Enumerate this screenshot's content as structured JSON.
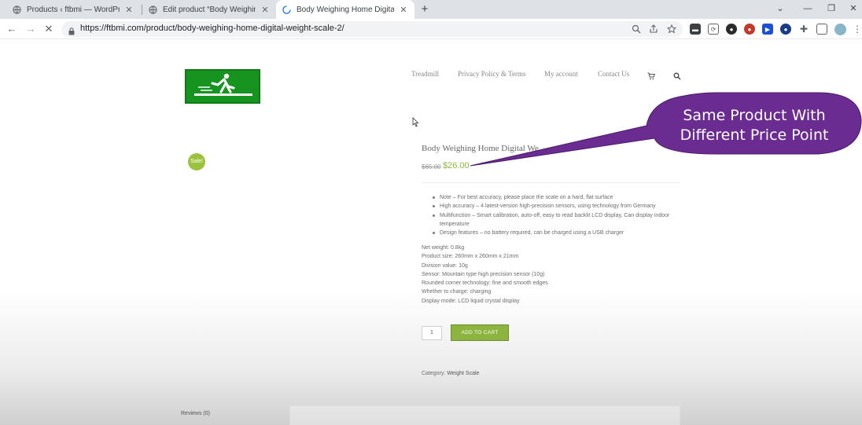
{
  "browser": {
    "tabs": [
      {
        "title": "Products ‹ ftbmi — WordPress",
        "icon": "globe-icon"
      },
      {
        "title": "Edit product “Body Weighing Ho",
        "icon": "globe-icon"
      },
      {
        "title": "Body Weighing Home Digital We",
        "icon": "loading-spinner-icon"
      }
    ],
    "url": "https://ftbmi.com/product/body-weighing-home-digital-weight-scale-2/"
  },
  "site": {
    "nav": [
      "Treadmill",
      "Privacy Policy & Terms",
      "My account",
      "Contact Us"
    ]
  },
  "product": {
    "sale_badge": "Sale!",
    "title": "Body Weighing Home Digital We",
    "price_old": "$65.00",
    "price_new": "$26.00",
    "bullets": [
      "Note – For best accuracy, please place the scale on a hard, flat surface",
      "High accuracy – 4 latest-version high-precision sensors, using technology from Germany",
      "Multifunction – Smart calibration, auto-off, easy to read backlit LCD display, Can display indoor",
      "temperature",
      "Design features – no battery required, can be charged using a USB charger"
    ],
    "specs": [
      "Net weight: 0.8kg",
      "Product size: 260mm x 260mm x 21mm",
      "Division value: 10g",
      "Sensor: Mountain type high precision sensor (10g)",
      "Rounded corner technology: fine and smooth edges",
      "Whether to charge: charging",
      "Display mode: LCD liquid crystal display"
    ],
    "quantity": "1",
    "add_to_cart": "ADD TO CART",
    "category_label": "Category:",
    "category_value": "Weight Scale",
    "reviews_tab": "Reviews (0)"
  },
  "callout": {
    "line1": "Same Product With",
    "line2": "Different Price Point",
    "color": "#6a2c91"
  }
}
